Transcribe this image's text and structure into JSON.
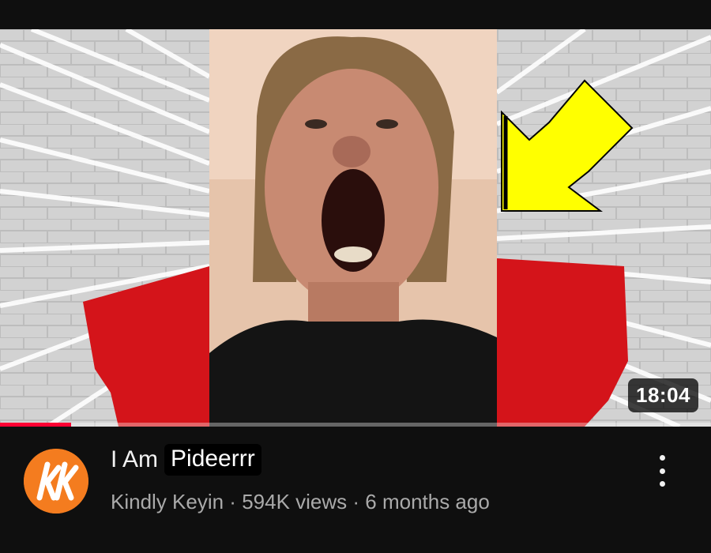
{
  "video": {
    "duration": "18:04",
    "watch_progress": 0.1,
    "title_prefix": "I Am",
    "title_highlight": "Pideerrr",
    "channel": "Kindly Keyin",
    "views": "594K views",
    "age": "6 months ago",
    "separator": " · "
  },
  "thumbnail": {
    "arrow_color": "#ffff00",
    "accent_red": "#d4141a"
  },
  "avatar": {
    "color": "#f47c1f",
    "icon": "kk-logo-icon"
  },
  "icons": {
    "more": "more-vert-icon"
  }
}
